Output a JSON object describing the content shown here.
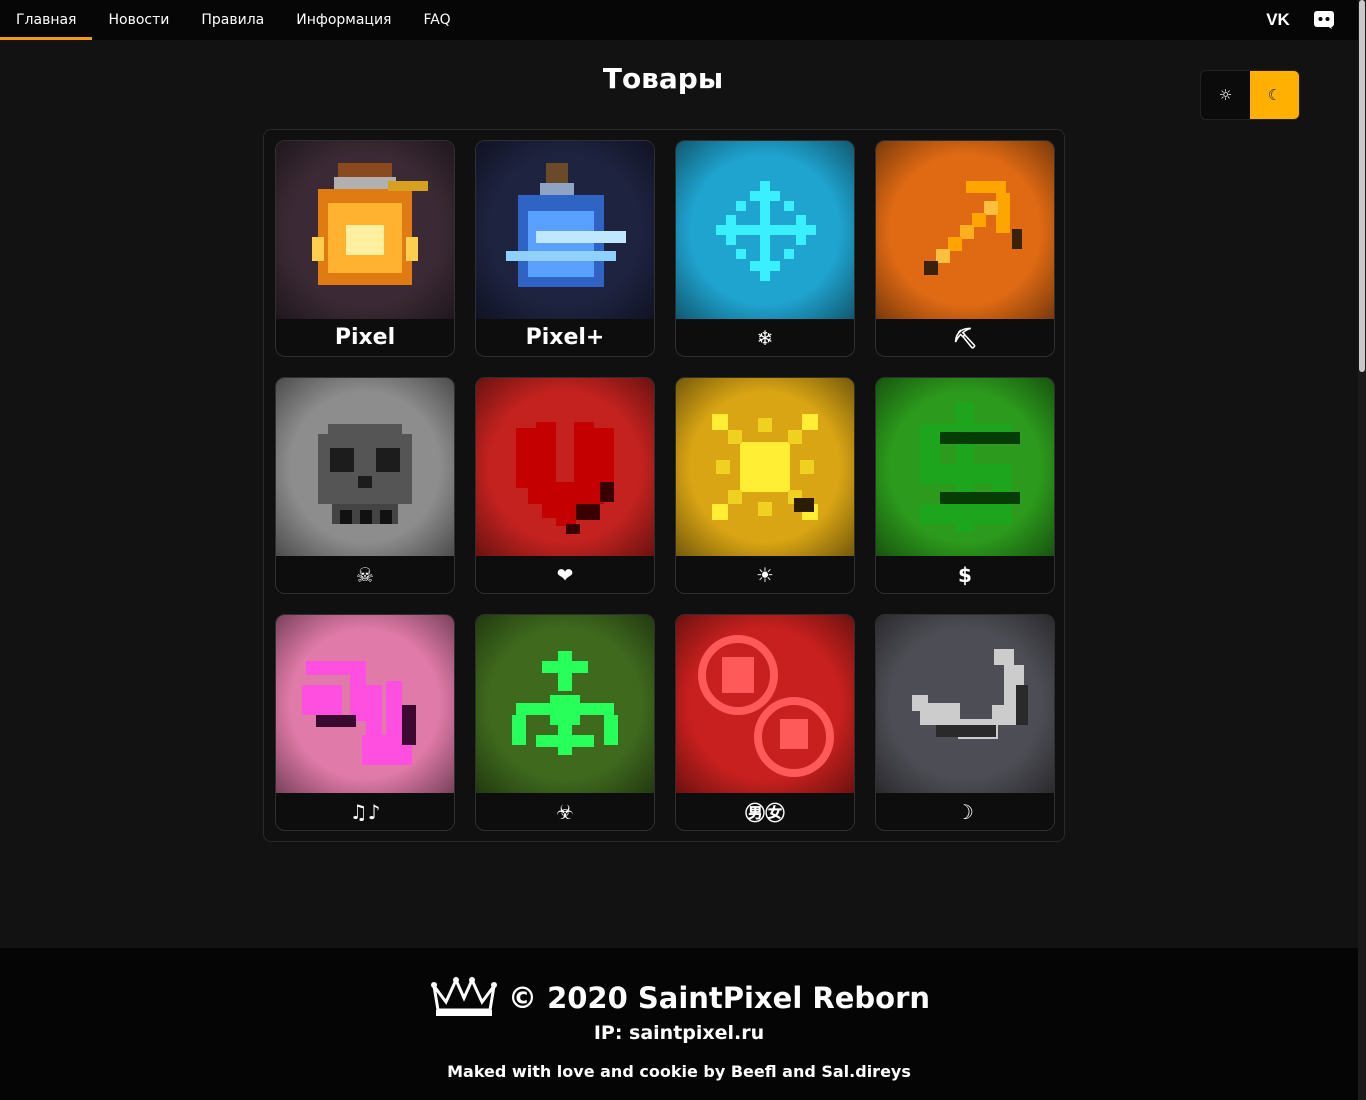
{
  "nav": {
    "items": [
      {
        "label": "Главная",
        "active": true
      },
      {
        "label": "Новости"
      },
      {
        "label": "Правила"
      },
      {
        "label": "Информация"
      },
      {
        "label": "FAQ"
      }
    ],
    "social": [
      {
        "icon": "vk-icon",
        "glyph": "VK"
      },
      {
        "icon": "discord-icon",
        "glyph": "◉"
      }
    ]
  },
  "page": {
    "title": "Товары"
  },
  "theme_toggle": {
    "light_icon": "☼",
    "dark_icon": "☾",
    "selected": "dark",
    "accent": "#ffb000"
  },
  "products": [
    {
      "label": "Pixel",
      "icon": "potion-orange",
      "bg": "#3b2a35"
    },
    {
      "label": "Pixel+",
      "icon": "potion-blue",
      "bg": "#1e2340"
    },
    {
      "label": "❄",
      "icon": "snowflake",
      "bg": "#1fa3cf"
    },
    {
      "label": "⛏",
      "icon": "pickaxe",
      "bg": "#e06a14"
    },
    {
      "label": "☠",
      "icon": "skull",
      "bg": "#8d8d8d"
    },
    {
      "label": "❤",
      "icon": "heart",
      "bg": "#c4221f"
    },
    {
      "label": "☀",
      "icon": "sun",
      "bg": "#d9a514"
    },
    {
      "label": "$",
      "icon": "dollar",
      "bg": "#2c9a1c"
    },
    {
      "label": "♫♪",
      "icon": "music",
      "bg": "#e07aa8"
    },
    {
      "label": "☣",
      "icon": "biohazard",
      "bg": "#3f6a1e"
    },
    {
      "label": "㊚㊛",
      "icon": "male-female",
      "bg": "#c8201e"
    },
    {
      "label": "☽",
      "icon": "moon",
      "bg": "#4d4d55"
    }
  ],
  "footer": {
    "copyright": "© 2020 SaintPixel Reborn",
    "ip": "IP: saintpixel.ru",
    "made": "Maked with love and cookie by Beefl and Sal.direys"
  }
}
